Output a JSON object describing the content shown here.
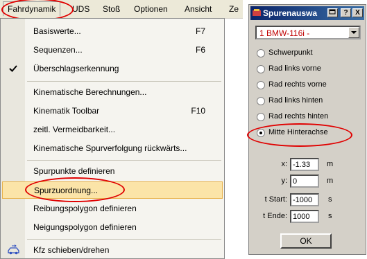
{
  "menubar": {
    "items": [
      "Fahrdynamik",
      "UDS",
      "Stoß",
      "Optionen",
      "Ansicht",
      "Ze"
    ]
  },
  "menu": {
    "items": [
      {
        "label": "Basiswerte...",
        "accel": "F7"
      },
      {
        "label": "Sequenzen...",
        "accel": "F6"
      },
      {
        "label": "Überschlagserkennung",
        "accel": "",
        "checked": true
      },
      {
        "label": "Kinematische Berechnungen...",
        "accel": ""
      },
      {
        "label": "Kinematik Toolbar",
        "accel": "F10"
      },
      {
        "label": "zeitl. Vermeidbarkeit...",
        "accel": ""
      },
      {
        "label": "Kinematische Spurverfolgung rückwärts...",
        "accel": ""
      },
      {
        "label": "Spurpunkte definieren",
        "accel": ""
      },
      {
        "label": "Spurzuordnung...",
        "accel": "",
        "highlighted": true
      },
      {
        "label": "Reibungspolygon definieren",
        "accel": ""
      },
      {
        "label": "Neigungspolygon definieren",
        "accel": ""
      },
      {
        "label": "Kfz schieben/drehen",
        "accel": "",
        "icon": "car-move-icon"
      }
    ]
  },
  "dialog": {
    "title": "Spurenauswa",
    "help_label": "?",
    "close_label": "X",
    "vehicle_select": "1  BMW-116i -",
    "radios": [
      {
        "label": "Schwerpunkt",
        "checked": false
      },
      {
        "label": "Rad links vorne",
        "checked": false
      },
      {
        "label": "Rad rechts vorne",
        "checked": false
      },
      {
        "label": "Rad links hinten",
        "checked": false
      },
      {
        "label": "Rad rechts hinten",
        "checked": false
      },
      {
        "label": "Mitte Hinterachse",
        "checked": true
      }
    ],
    "fields": [
      {
        "label": "x:",
        "value": "-1.33",
        "unit": "m"
      },
      {
        "label": "y:",
        "value": "0",
        "unit": "m"
      },
      {
        "label": "t Start:",
        "value": "-1000",
        "unit": "s"
      },
      {
        "label": "t Ende:",
        "value": "1000",
        "unit": "s"
      }
    ],
    "ok_label": "OK"
  },
  "colors": {
    "annotation": "#e00000",
    "menu_highlight": "#fbe4a8",
    "title_gradient_start": "#0a246a",
    "select_text": "#c00000"
  }
}
